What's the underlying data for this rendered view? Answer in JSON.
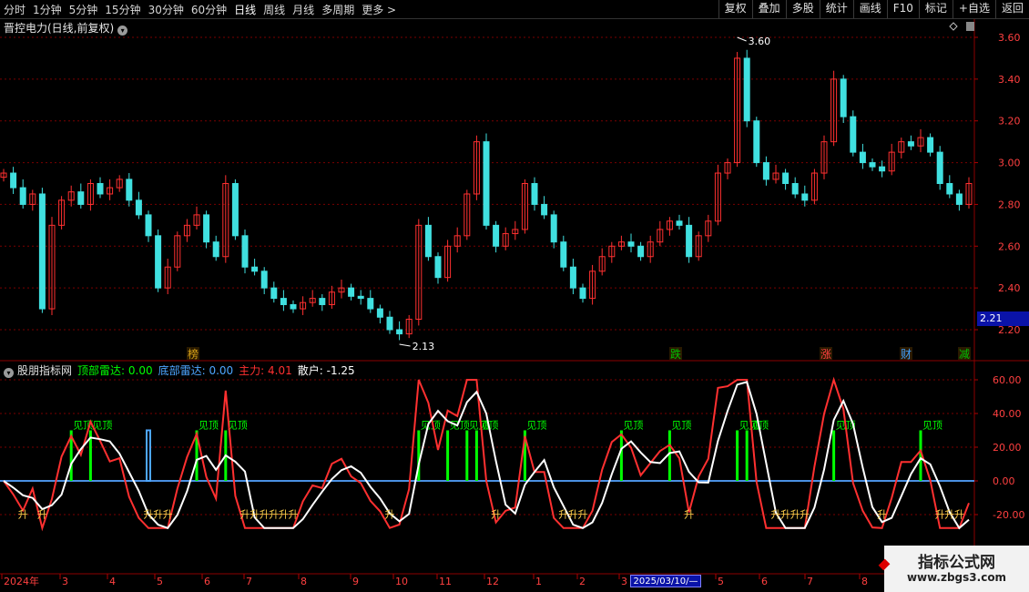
{
  "toolbar": {
    "periods": [
      "分时",
      "1分钟",
      "5分钟",
      "15分钟",
      "30分钟",
      "60分钟",
      "日线",
      "周线",
      "月线",
      "多周期",
      "更多 >"
    ],
    "active": "日线",
    "actions": [
      "复权",
      "叠加",
      "多股",
      "统计",
      "画线",
      "F10",
      "标记",
      "+自选",
      "返回"
    ]
  },
  "stock_title": "晋控电力(日线,前复权)",
  "price_axis": [
    "3.60",
    "3.40",
    "3.20",
    "3.00",
    "2.80",
    "2.60",
    "2.40",
    "2.20"
  ],
  "price_tag": "2.21",
  "high_label": "3.60",
  "low_label": "2.13",
  "event_tags": [
    {
      "text": "榜",
      "color": "#d4a017"
    },
    {
      "text": "跌",
      "color": "#00c000"
    },
    {
      "text": "涨",
      "color": "#ff4040"
    },
    {
      "text": "财",
      "color": "#40a0ff"
    },
    {
      "text": "减",
      "color": "#00c000"
    }
  ],
  "indicator": {
    "name": "股朋指标网",
    "items": [
      {
        "label": "顶部雷达: 0.00",
        "color": "#00ff00"
      },
      {
        "label": "底部雷达: 0.00",
        "color": "#4da6ff"
      },
      {
        "label": "主力: 4.01",
        "color": "#ff3030"
      },
      {
        "label": "散户: -1.25",
        "color": "#ffffff"
      }
    ],
    "axis": [
      "60.00",
      "40.00",
      "20.00",
      "0.00",
      "-20.00"
    ],
    "top_signal": "见顶",
    "bottom_signal": "升"
  },
  "date_axis": [
    "2024年",
    "3",
    "4",
    "5",
    "6",
    "7",
    "8",
    "9",
    "10",
    "11",
    "12",
    "1",
    "2",
    "3",
    "5",
    "6",
    "7",
    "8"
  ],
  "date_tag": "2025/03/10/—",
  "watermark": {
    "title": "指标公式网",
    "url": "www.zbgs3.com"
  },
  "colors": {
    "up": "#ff3030",
    "down": "#40e0e0",
    "white_line": "#ffffff",
    "zero_line": "#4a90e2",
    "top_radar": "#00ff00",
    "bottom_radar": "#4da6ff"
  },
  "chart_data": {
    "type": "candlestick",
    "title": "晋控电力(日线,前复权)",
    "ylim": [
      2.13,
      3.6
    ],
    "close_series": [
      2.95,
      2.88,
      2.8,
      2.85,
      2.3,
      2.7,
      2.82,
      2.86,
      2.8,
      2.9,
      2.85,
      2.88,
      2.92,
      2.82,
      2.75,
      2.65,
      2.4,
      2.5,
      2.65,
      2.7,
      2.75,
      2.62,
      2.55,
      2.9,
      2.65,
      2.5,
      2.48,
      2.4,
      2.35,
      2.32,
      2.3,
      2.33,
      2.35,
      2.32,
      2.38,
      2.4,
      2.36,
      2.35,
      2.3,
      2.26,
      2.2,
      2.18,
      2.25,
      2.7,
      2.55,
      2.45,
      2.6,
      2.65,
      2.85,
      3.1,
      2.7,
      2.6,
      2.66,
      2.68,
      2.9,
      2.8,
      2.75,
      2.62,
      2.5,
      2.4,
      2.35,
      2.48,
      2.55,
      2.6,
      2.62,
      2.6,
      2.55,
      2.62,
      2.68,
      2.72,
      2.7,
      2.55,
      2.65,
      2.72,
      2.95,
      3.0,
      3.5,
      3.2,
      3.0,
      2.92,
      2.95,
      2.9,
      2.85,
      2.82,
      2.95,
      3.1,
      3.4,
      3.22,
      3.05,
      3.0,
      2.98,
      2.96,
      3.05,
      3.1,
      3.08,
      3.12,
      3.05,
      2.9,
      2.85,
      2.8,
      2.9
    ]
  }
}
